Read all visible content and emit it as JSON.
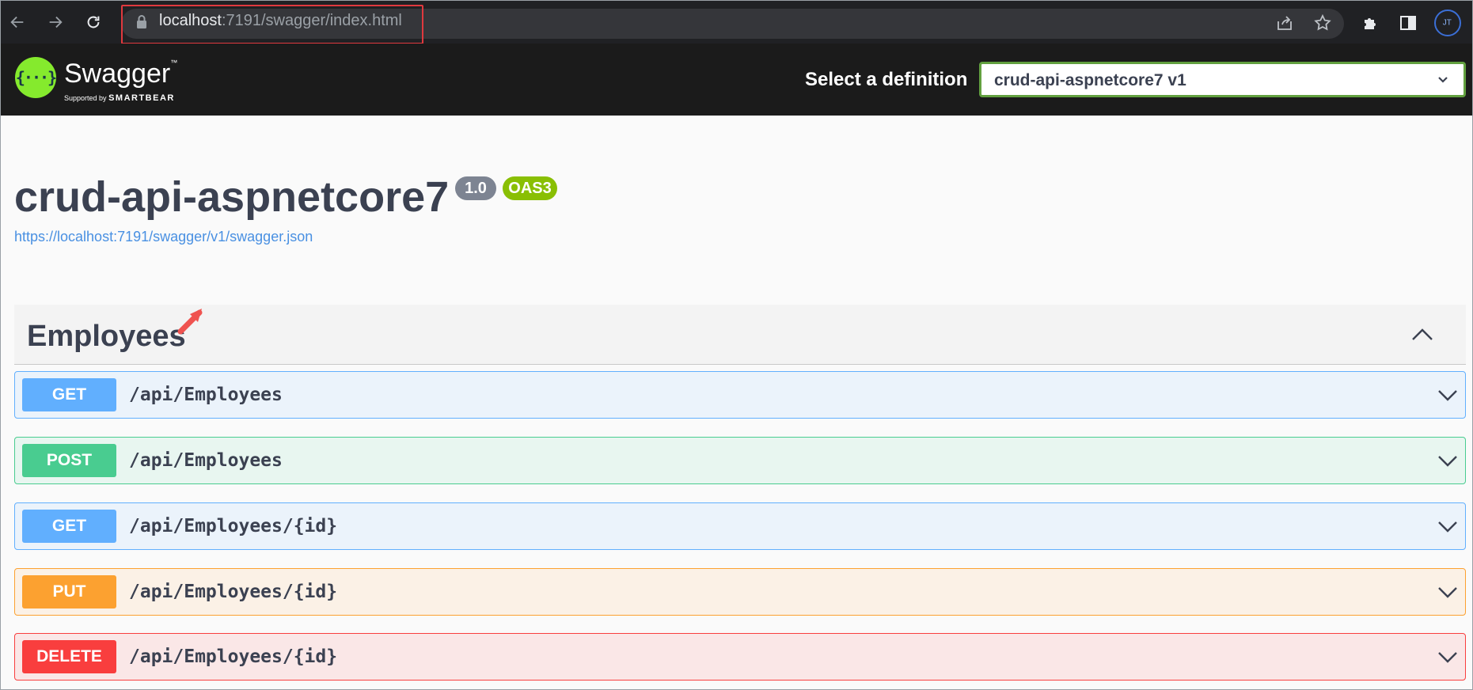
{
  "browser": {
    "url_host": "localhost",
    "url_rest": ":7191/swagger/index.html",
    "profile_initials": "JT",
    "icons": [
      "back-arrow-icon",
      "forward-arrow-icon",
      "reload-icon",
      "lock-icon",
      "share-icon",
      "star-icon",
      "puzzle-icon",
      "side-panel-icon"
    ]
  },
  "topbar": {
    "logo_glyph": "{···}",
    "brand": "Swagger",
    "brand_tm": "™",
    "supported_by": "Supported by",
    "smartbear": "SMARTBEAR",
    "definition_label": "Select a definition",
    "definition_selected": "crud-api-aspnetcore7 v1"
  },
  "info": {
    "title": "crud-api-aspnetcore7",
    "version": "1.0",
    "oas": "OAS3",
    "spec_url": "https://localhost:7191/swagger/v1/swagger.json"
  },
  "tag": {
    "name": "Employees"
  },
  "operations": [
    {
      "method": "GET",
      "path": "/api/Employees"
    },
    {
      "method": "POST",
      "path": "/api/Employees"
    },
    {
      "method": "GET",
      "path": "/api/Employees/{id}"
    },
    {
      "method": "PUT",
      "path": "/api/Employees/{id}"
    },
    {
      "method": "DELETE",
      "path": "/api/Employees/{id}"
    }
  ],
  "colors": {
    "get": "#61affe",
    "post": "#49cc90",
    "put": "#fca130",
    "delete": "#f93e3e",
    "swagger_green": "#85ea2d",
    "highlight_red": "#e0393e"
  }
}
